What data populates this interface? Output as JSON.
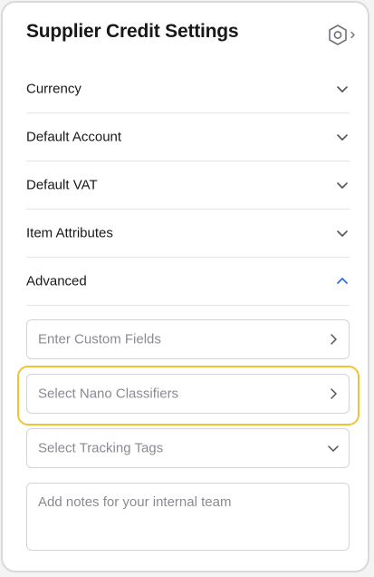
{
  "title": "Supplier Credit Settings",
  "icons": {
    "settings": "hexagon-settings-icon",
    "collapsed": "chevron-down-icon",
    "expanded": "chevron-up-icon",
    "forward": "chevron-right-icon"
  },
  "colors": {
    "accent": "#2563eb",
    "highlight": "#f1c232"
  },
  "sections": [
    {
      "label": "Currency",
      "state": "collapsed"
    },
    {
      "label": "Default Account",
      "state": "collapsed"
    },
    {
      "label": "Default VAT",
      "state": "collapsed"
    },
    {
      "label": "Item Attributes",
      "state": "collapsed"
    },
    {
      "label": "Advanced",
      "state": "expanded"
    }
  ],
  "advanced": {
    "custom_fields": "Enter Custom Fields",
    "nano_classifiers": "Select Nano Classifiers",
    "tracking_tags": "Select Tracking Tags",
    "notes_placeholder": "Add notes for your internal team"
  }
}
